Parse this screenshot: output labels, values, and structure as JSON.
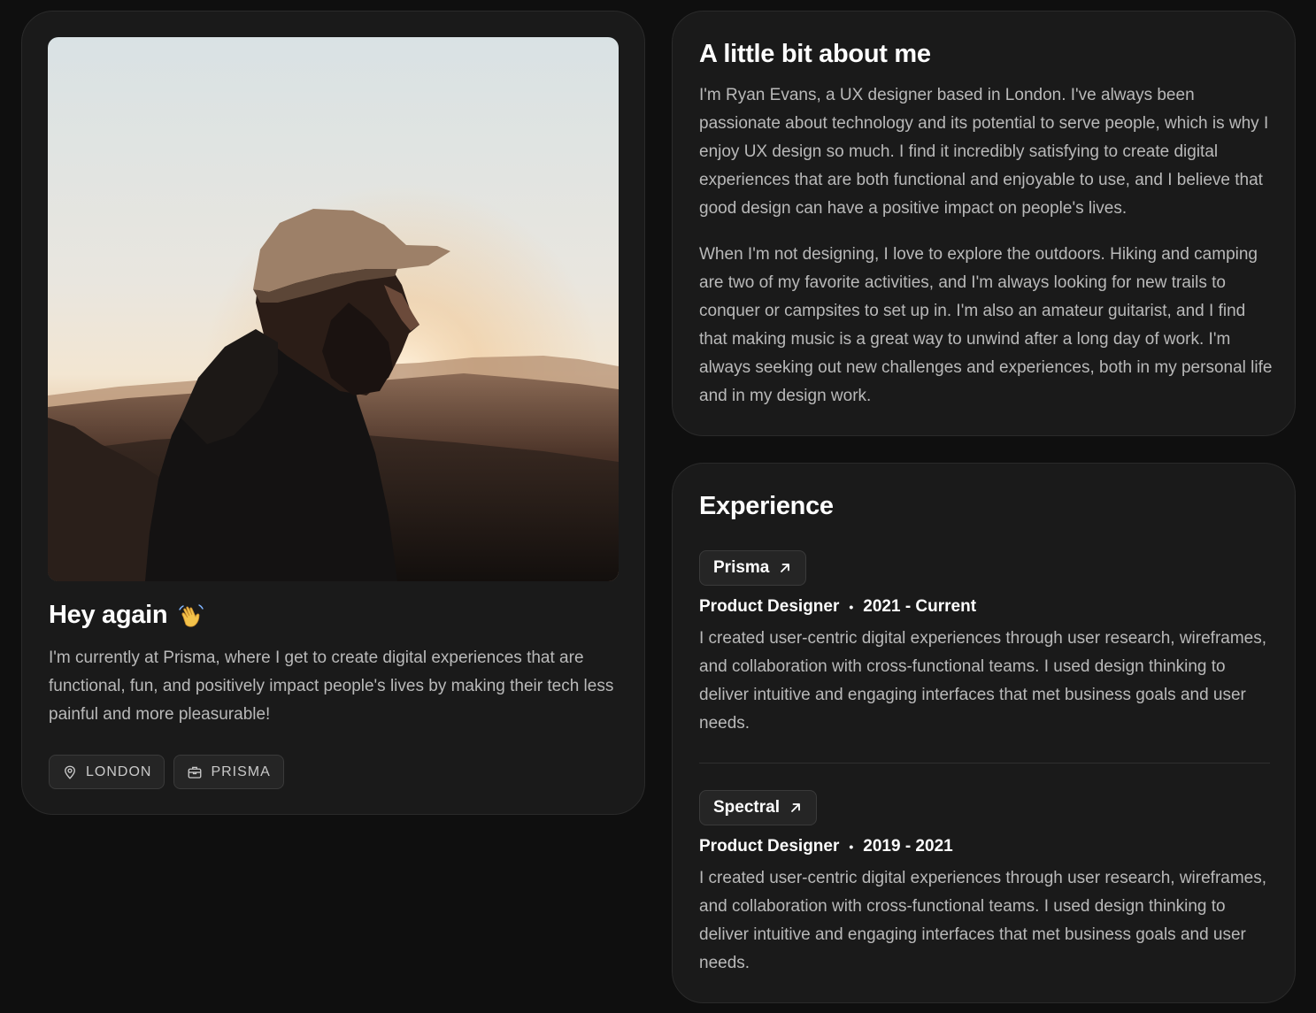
{
  "profile": {
    "title": "Hey again",
    "title_icon": "waving-hand-icon",
    "description": "I'm currently at Prisma, where I get to create digital experiences that are functional, fun, and positively impact people's lives by making their tech less painful and more pleasurable!",
    "tags": [
      {
        "label": "LONDON",
        "icon": "location-pin-icon"
      },
      {
        "label": "PRISMA",
        "icon": "briefcase-icon"
      }
    ]
  },
  "about": {
    "title": "A little bit about me",
    "paragraphs": [
      "I'm Ryan Evans, a UX designer based in London. I've always been passionate about technology and its potential to serve people, which is why I enjoy UX design so much. I find it incredibly satisfying to create digital experiences that are both functional and enjoyable to use, and I believe that good design can have a positive impact on people's lives.",
      "When I'm not designing, I love to explore the outdoors. Hiking and camping are two of my favorite activities, and I'm always looking for new trails to conquer or campsites to set up in. I'm also an amateur guitarist, and I find that making music is a great way to unwind after a long day of work. I'm always seeking out new challenges and experiences, both in my personal life and in my design work."
    ]
  },
  "experience": {
    "title": "Experience",
    "items": [
      {
        "company": "Prisma",
        "role": "Product Designer",
        "period": "2021 - Current",
        "description": "I created user-centric digital experiences through user research, wireframes, and collaboration with cross-functional teams. I used design thinking to deliver intuitive and engaging interfaces that met business goals and user needs."
      },
      {
        "company": "Spectral",
        "role": "Product Designer",
        "period": "2019 - 2021",
        "description": "I created user-centric digital experiences through user research, wireframes, and collaboration with cross-functional teams. I used design thinking to deliver intuitive and engaging interfaces that met business goals and user needs."
      }
    ],
    "separator": "•",
    "link_icon": "arrow-up-right-icon"
  },
  "colors": {
    "background": "#0f0f0f",
    "card": "#1a1a1a",
    "text_primary": "#ffffff",
    "text_secondary": "#b9b9b9"
  }
}
